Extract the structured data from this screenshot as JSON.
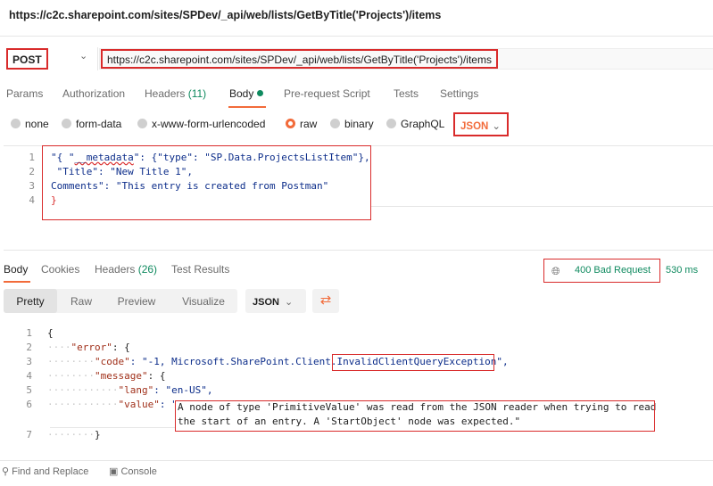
{
  "request": {
    "title": "https://c2c.sharepoint.com/sites/SPDev/_api/web/lists/GetByTitle('Projects')/items",
    "method": "POST",
    "url": "https://c2c.sharepoint.com/sites/SPDev/_api/web/lists/GetByTitle('Projects')/items"
  },
  "request_tabs": [
    {
      "label": "Params"
    },
    {
      "label": "Authorization"
    },
    {
      "label": "Headers",
      "count": "(11)"
    },
    {
      "label": "Body"
    },
    {
      "label": "Pre-request Script"
    },
    {
      "label": "Tests"
    },
    {
      "label": "Settings"
    }
  ],
  "body_types": [
    "none",
    "form-data",
    "x-www-form-urlencoded",
    "raw",
    "binary",
    "GraphQL"
  ],
  "body_type_selected": "raw",
  "body_format": "JSON",
  "request_body": {
    "line_numbers": [
      "1",
      "2",
      "3",
      "4"
    ],
    "line1": {
      "a": "\"{ \"",
      "b": "__metadata",
      "c": "\": {\"type\": \"SP.Data.ProjectsListItem\"},"
    },
    "line2": " \"Title\": \"New Title 1\",",
    "line3": "Comments\": \"This entry is created from Postman\"",
    "line4": "}"
  },
  "response_tabs": [
    {
      "label": "Body"
    },
    {
      "label": "Cookies"
    },
    {
      "label": "Headers",
      "count": "(26)"
    },
    {
      "label": "Test Results"
    }
  ],
  "response_status": {
    "icon": "globe-icon",
    "status": "400 Bad Request",
    "time": "530 ms"
  },
  "view_modes": [
    "Pretty",
    "Raw",
    "Preview",
    "Visualize"
  ],
  "response_format": "JSON",
  "response_body": {
    "line_numbers": [
      "1",
      "2",
      "3",
      "4",
      "5",
      "6",
      "7"
    ],
    "l1": "{",
    "l2_key": "\"error\"",
    "l2_rest": ": {",
    "l3_key": "\"code\"",
    "l3_mid": ": \"-1, Microsoft.SharePoint.Client.",
    "l3_exc": "InvalidClientQueryException",
    "l3_end": "\",",
    "l4_key": "\"message\"",
    "l4_rest": ": {",
    "l5_key": "\"lang\"",
    "l5_rest": ": \"en-US\",",
    "l6_key": "\"value\"",
    "l6_rest": ": \"",
    "l6_value1": "A node of type 'PrimitiveValue' was read from the JSON reader when trying to read",
    "l6_value2": "the start of an entry. A 'StartObject' node was expected.\"",
    "l7": "}"
  },
  "footer": {
    "find_replace": "Find and Replace",
    "console": "Console"
  },
  "colors": {
    "accent": "#f26b3a",
    "highlight_box": "#d92b2b",
    "status_text": "#0f8a5f"
  }
}
